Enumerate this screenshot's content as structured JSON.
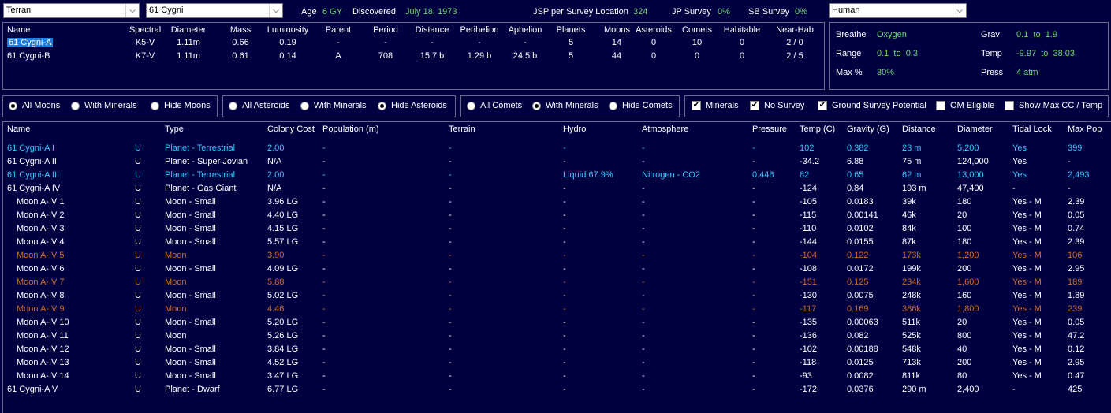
{
  "top": {
    "race_select": "Terran",
    "system_select": "61 Cygni",
    "age_label": "Age",
    "age_value": "6 GY",
    "discovered_label": "Discovered",
    "discovered_value": "July 18, 1973",
    "jsp_label": "JSP per Survey Location",
    "jsp_value": "324",
    "jp_label": "JP Survey",
    "jp_value": "0%",
    "sb_label": "SB Survey",
    "sb_value": "0%",
    "species_select": "Human"
  },
  "stars": {
    "headers": [
      "Name",
      "Spectral",
      "Diameter",
      "Mass",
      "Luminosity",
      "Parent",
      "Period",
      "Distance",
      "Perihelion",
      "Aphelion",
      "Planets",
      "Moons",
      "Asteroids",
      "Comets",
      "Habitable",
      "Near-Hab"
    ],
    "rows": [
      [
        "61 Cygni-A",
        "K5-V",
        "1.11m",
        "0.66",
        "0.19",
        "-",
        "-",
        "-",
        "-",
        "-",
        "5",
        "14",
        "0",
        "10",
        "0",
        "2 / 0"
      ],
      [
        "61 Cygni-B",
        "K7-V",
        "1.11m",
        "0.61",
        "0.14",
        "A",
        "708",
        "15.7 b",
        "1.29 b",
        "24.5 b",
        "5",
        "44",
        "0",
        "0",
        "0",
        "2 / 5"
      ]
    ]
  },
  "species": {
    "breathe_label": "Breathe",
    "breathe_value": "Oxygen",
    "range_label": "Range",
    "range_value": "0.1  to  0.3",
    "max_label": "Max %",
    "max_value": "30%",
    "grav_label": "Grav",
    "grav_value": "0.1  to  1.9",
    "temp_label": "Temp",
    "temp_value": "-9.97  to  38.03",
    "press_label": "Press",
    "press_value": "4 atm"
  },
  "filters": {
    "moons": [
      "All Moons",
      "With Minerals",
      "Hide Moons"
    ],
    "moons_selected": 0,
    "asteroids": [
      "All Asteroids",
      "With Minerals",
      "Hide Asteroids"
    ],
    "asteroids_selected": 2,
    "comets": [
      "All Comets",
      "With Minerals",
      "Hide Comets"
    ],
    "comets_selected": 1,
    "checks": [
      {
        "label": "Minerals",
        "checked": true
      },
      {
        "label": "No Survey",
        "checked": true
      },
      {
        "label": "Ground Survey Potential",
        "checked": true
      },
      {
        "label": "OM Eligible",
        "checked": false
      },
      {
        "label": "Show Max CC / Temp",
        "checked": false
      }
    ]
  },
  "bodies": {
    "headers": [
      "Name",
      "",
      "Type",
      "Colony Cost",
      "Population (m)",
      "Terrain",
      "Hydro",
      "Atmosphere",
      "Pressure",
      "Temp (C)",
      "Gravity (G)",
      "Distance",
      "Diameter",
      "Tidal Lock",
      "Max Pop"
    ],
    "colors": {
      "cyan": "#38c8ff",
      "white": "#ffffff",
      "orange": "#d06a2a"
    },
    "rows": [
      {
        "c": "cyan",
        "indent": false,
        "v": [
          "61 Cygni-A I",
          "U",
          "Planet - Terrestrial",
          "2.00",
          "-",
          "-",
          "-",
          "-",
          "-",
          "102",
          "0.382",
          "23 m",
          "5,200",
          "Yes",
          "399"
        ]
      },
      {
        "c": "white",
        "indent": false,
        "v": [
          "61 Cygni-A II",
          "U",
          "Planet - Super Jovian",
          "N/A",
          "-",
          "-",
          "-",
          "-",
          "-",
          "-34.2",
          "6.88",
          "75 m",
          "124,000",
          "Yes",
          "-"
        ]
      },
      {
        "c": "cyan",
        "indent": false,
        "v": [
          "61 Cygni-A III",
          "U",
          "Planet - Terrestrial",
          "2.00",
          "-",
          "-",
          "Liquid 67.9%",
          "Nitrogen - CO2",
          "0.446",
          "82",
          "0.65",
          "62 m",
          "13,000",
          "Yes",
          "2,493"
        ]
      },
      {
        "c": "white",
        "indent": false,
        "v": [
          "61 Cygni-A IV",
          "U",
          "Planet - Gas Giant",
          "N/A",
          "-",
          "-",
          "-",
          "-",
          "-",
          "-124",
          "0.84",
          "193 m",
          "47,400",
          "-",
          "-"
        ]
      },
      {
        "c": "white",
        "indent": true,
        "v": [
          "Moon A-IV 1",
          "U",
          "Moon - Small",
          "3.96 LG",
          "-",
          "-",
          "-",
          "-",
          "-",
          "-105",
          "0.0183",
          "39k",
          "180",
          "Yes - M",
          "2.39"
        ]
      },
      {
        "c": "white",
        "indent": true,
        "v": [
          "Moon A-IV 2",
          "U",
          "Moon - Small",
          "4.40 LG",
          "-",
          "-",
          "-",
          "-",
          "-",
          "-115",
          "0.00141",
          "46k",
          "20",
          "Yes - M",
          "0.05"
        ]
      },
      {
        "c": "white",
        "indent": true,
        "v": [
          "Moon A-IV 3",
          "U",
          "Moon - Small",
          "4.15 LG",
          "-",
          "-",
          "-",
          "-",
          "-",
          "-110",
          "0.0102",
          "84k",
          "100",
          "Yes - M",
          "0.74"
        ]
      },
      {
        "c": "white",
        "indent": true,
        "v": [
          "Moon A-IV 4",
          "U",
          "Moon - Small",
          "5.57 LG",
          "-",
          "-",
          "-",
          "-",
          "-",
          "-144",
          "0.0155",
          "87k",
          "180",
          "Yes - M",
          "2.39"
        ]
      },
      {
        "c": "orange",
        "indent": true,
        "v": [
          "Moon A-IV 5",
          "U",
          "Moon",
          "3.90",
          "-",
          "-",
          "-",
          "-",
          "-",
          "-104",
          "0.122",
          "173k",
          "1,200",
          "Yes - M",
          "106"
        ]
      },
      {
        "c": "white",
        "indent": true,
        "v": [
          "Moon A-IV 6",
          "U",
          "Moon - Small",
          "4.09 LG",
          "-",
          "-",
          "-",
          "-",
          "-",
          "-108",
          "0.0172",
          "199k",
          "200",
          "Yes - M",
          "2.95"
        ]
      },
      {
        "c": "orange",
        "indent": true,
        "v": [
          "Moon A-IV 7",
          "U",
          "Moon",
          "5.88",
          "-",
          "-",
          "-",
          "-",
          "-",
          "-151",
          "0.125",
          "234k",
          "1,600",
          "Yes - M",
          "189"
        ]
      },
      {
        "c": "white",
        "indent": true,
        "v": [
          "Moon A-IV 8",
          "U",
          "Moon - Small",
          "5.02 LG",
          "-",
          "-",
          "-",
          "-",
          "-",
          "-130",
          "0.0075",
          "248k",
          "160",
          "Yes - M",
          "1.89"
        ]
      },
      {
        "c": "orange",
        "indent": true,
        "v": [
          "Moon A-IV 9",
          "U",
          "Moon",
          "4.46",
          "-",
          "-",
          "-",
          "-",
          "-",
          "-117",
          "0.169",
          "386k",
          "1,800",
          "Yes - M",
          "239"
        ]
      },
      {
        "c": "white",
        "indent": true,
        "v": [
          "Moon A-IV 10",
          "U",
          "Moon - Small",
          "5.20 LG",
          "-",
          "-",
          "-",
          "-",
          "-",
          "-135",
          "0.00063",
          "511k",
          "20",
          "Yes - M",
          "0.05"
        ]
      },
      {
        "c": "white",
        "indent": true,
        "v": [
          "Moon A-IV 11",
          "U",
          "Moon",
          "5.26 LG",
          "-",
          "-",
          "-",
          "-",
          "-",
          "-136",
          "0.082",
          "525k",
          "800",
          "Yes - M",
          "47.2"
        ]
      },
      {
        "c": "white",
        "indent": true,
        "v": [
          "Moon A-IV 12",
          "U",
          "Moon - Small",
          "3.84 LG",
          "-",
          "-",
          "-",
          "-",
          "-",
          "-102",
          "0.00188",
          "548k",
          "40",
          "Yes - M",
          "0.12"
        ]
      },
      {
        "c": "white",
        "indent": true,
        "v": [
          "Moon A-IV 13",
          "U",
          "Moon - Small",
          "4.52 LG",
          "-",
          "-",
          "-",
          "-",
          "-",
          "-118",
          "0.0125",
          "713k",
          "200",
          "Yes - M",
          "2.95"
        ]
      },
      {
        "c": "white",
        "indent": true,
        "v": [
          "Moon A-IV 14",
          "U",
          "Moon - Small",
          "3.47 LG",
          "-",
          "-",
          "-",
          "-",
          "-",
          "-93",
          "0.0082",
          "811k",
          "80",
          "Yes - M",
          "0.47"
        ]
      },
      {
        "c": "white",
        "indent": false,
        "v": [
          "61 Cygni-A V",
          "U",
          "Planet - Dwarf",
          "6.77 LG",
          "-",
          "-",
          "-",
          "-",
          "-",
          "-172",
          "0.0376",
          "290 m",
          "2,400",
          "-",
          "425"
        ]
      }
    ]
  }
}
